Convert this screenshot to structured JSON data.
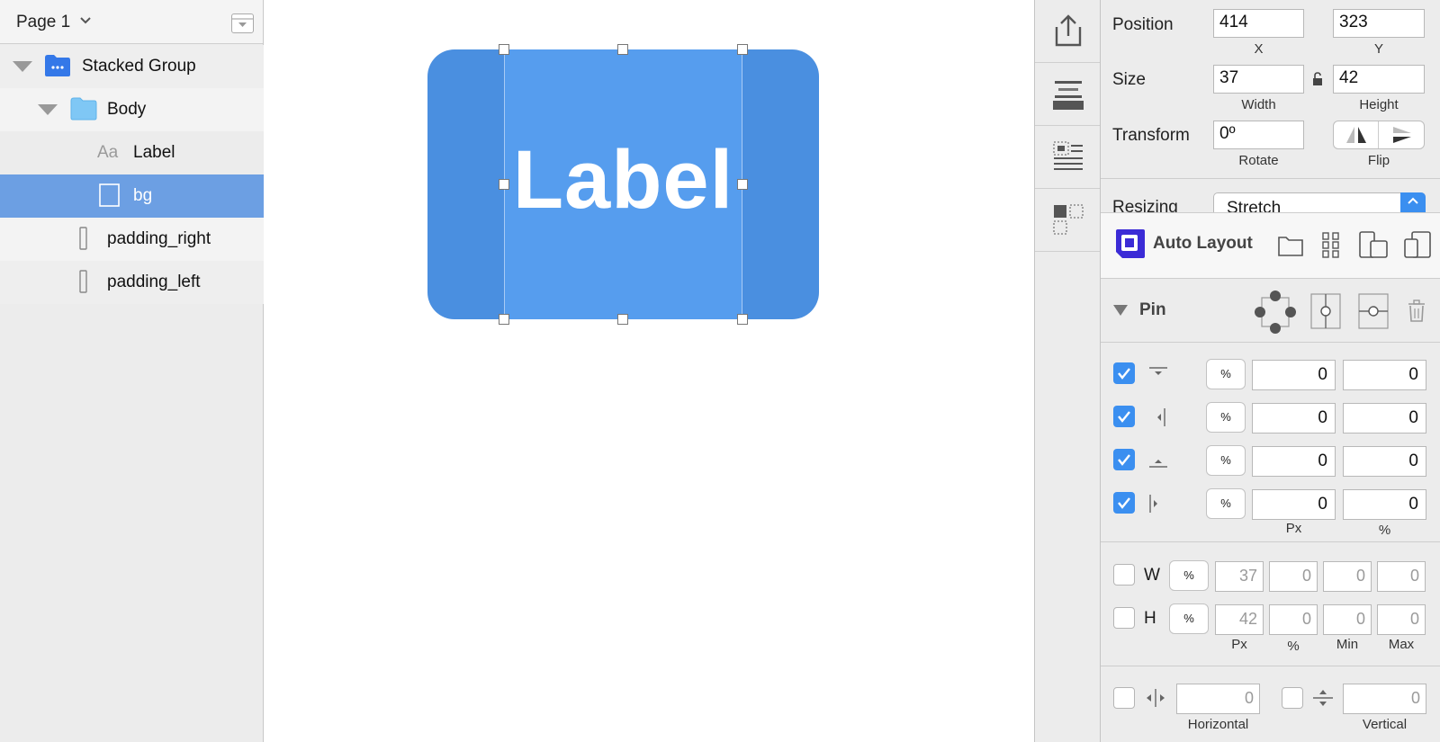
{
  "layers": {
    "page_name": "Page 1",
    "items": [
      {
        "name": "Stacked Group"
      },
      {
        "name": "Body"
      },
      {
        "name": "Label",
        "type_glyph": "Aa"
      },
      {
        "name": "bg"
      },
      {
        "name": "padding_right"
      },
      {
        "name": "padding_left"
      }
    ]
  },
  "canvas": {
    "button_label": "Label",
    "colors": {
      "outer": "#4a8fe0",
      "inner": "#569dee",
      "text": "#ffffff"
    }
  },
  "inspector": {
    "position": {
      "label": "Position",
      "x": "414",
      "y": "323",
      "x_caption": "X",
      "y_caption": "Y"
    },
    "size": {
      "label": "Size",
      "width": "37",
      "height": "42",
      "width_caption": "Width",
      "height_caption": "Height"
    },
    "transform": {
      "label": "Transform",
      "rotate": "0º",
      "rotate_caption": "Rotate",
      "flip_caption": "Flip"
    },
    "resizing": {
      "label": "Resizing",
      "value": "Stretch"
    },
    "auto_layout": {
      "title": "Auto Layout"
    },
    "pin": {
      "title": "Pin",
      "rows": [
        {
          "checked": true,
          "pct": "%",
          "px": "0",
          "percent": "0"
        },
        {
          "checked": true,
          "pct": "%",
          "px": "0",
          "percent": "0"
        },
        {
          "checked": true,
          "pct": "%",
          "px": "0",
          "percent": "0"
        },
        {
          "checked": true,
          "pct": "%",
          "px": "0",
          "percent": "0"
        }
      ],
      "px_caption": "Px",
      "percent_caption": "%"
    },
    "size_constraints": {
      "w": {
        "label": "W",
        "pct": "%",
        "px": "37",
        "percent": "0",
        "min": "0",
        "max": "0"
      },
      "h": {
        "label": "H",
        "pct": "%",
        "px": "42",
        "percent": "0",
        "min": "0",
        "max": "0"
      },
      "captions": {
        "px": "Px",
        "percent": "%",
        "min": "Min",
        "max": "Max"
      }
    },
    "stack": {
      "horizontal_value": "0",
      "vertical_value": "0",
      "horizontal_caption": "Horizontal",
      "vertical_caption": "Vertical"
    },
    "accent_color": "#3b8ff0",
    "selection_color": "#6c9fe3"
  }
}
